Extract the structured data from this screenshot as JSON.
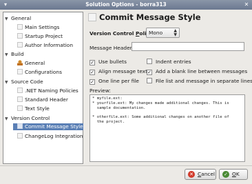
{
  "window": {
    "title": "Solution Options - borra313",
    "menu_icon": "window-menu-icon",
    "close_icon": "close-icon"
  },
  "tree": {
    "sections": [
      {
        "label": "General",
        "items": [
          {
            "label": "Main Settings",
            "icon": "page-icon"
          },
          {
            "label": "Startup Project",
            "icon": "page-icon"
          },
          {
            "label": "Author Information",
            "icon": "page-icon"
          }
        ]
      },
      {
        "label": "Build",
        "items": [
          {
            "label": "General",
            "icon": "user-icon"
          },
          {
            "label": "Configurations",
            "icon": "page-icon"
          }
        ]
      },
      {
        "label": "Source Code",
        "items": [
          {
            "label": ".NET Naming Policies",
            "icon": "page-icon"
          },
          {
            "label": "Standard Header",
            "icon": "page-icon"
          },
          {
            "label": "Text Style",
            "icon": "page-icon"
          }
        ]
      },
      {
        "label": "Version Control",
        "items": [
          {
            "label": "Commit Message Style",
            "icon": "page-icon",
            "selected": true
          },
          {
            "label": "ChangeLog Integration",
            "icon": "page-icon"
          }
        ]
      }
    ]
  },
  "panel": {
    "title": "Commit Message Style",
    "policy_label_pre": "Version Control ",
    "policy_label_accel": "P",
    "policy_label_post": "olicy:",
    "policy_value": "Mono",
    "header_label": "Message Header:",
    "header_value": "",
    "options": [
      {
        "label": "Use bullets",
        "checked": true
      },
      {
        "label": "Indent entries",
        "checked": false
      },
      {
        "label": "Align message text",
        "checked": true
      },
      {
        "label": "Add a blank line between messages",
        "checked": true
      },
      {
        "label": "One line per file",
        "checked": true
      },
      {
        "label": "File list and message in separate lines",
        "checked": false
      }
    ],
    "preview_label": "Preview:",
    "preview_text": "* myfile.ext:\n* yourfile.ext: My changes made additional changes. This is\n  sample documentation.\n\n* otherfile.ext: Some additional changes on another file of\n  the project."
  },
  "buttons": {
    "cancel": {
      "pre": "",
      "accel": "C",
      "post": "ancel"
    },
    "ok": {
      "pre": "",
      "accel": "O",
      "post": "K"
    }
  }
}
